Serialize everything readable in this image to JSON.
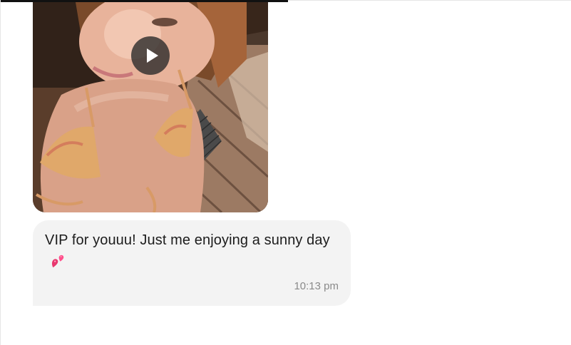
{
  "message": {
    "media": {
      "type": "video",
      "play_icon": "play-icon"
    },
    "text": "VIP for youuu! Just me enjoying a sunny day",
    "emoji": "two-hearts-emoji",
    "time": "10:13 pm"
  },
  "colors": {
    "bubble_background": "#f3f3f3",
    "text": "#1c1c1c",
    "timestamp": "#8a8a8a",
    "play_button": "#282828"
  }
}
